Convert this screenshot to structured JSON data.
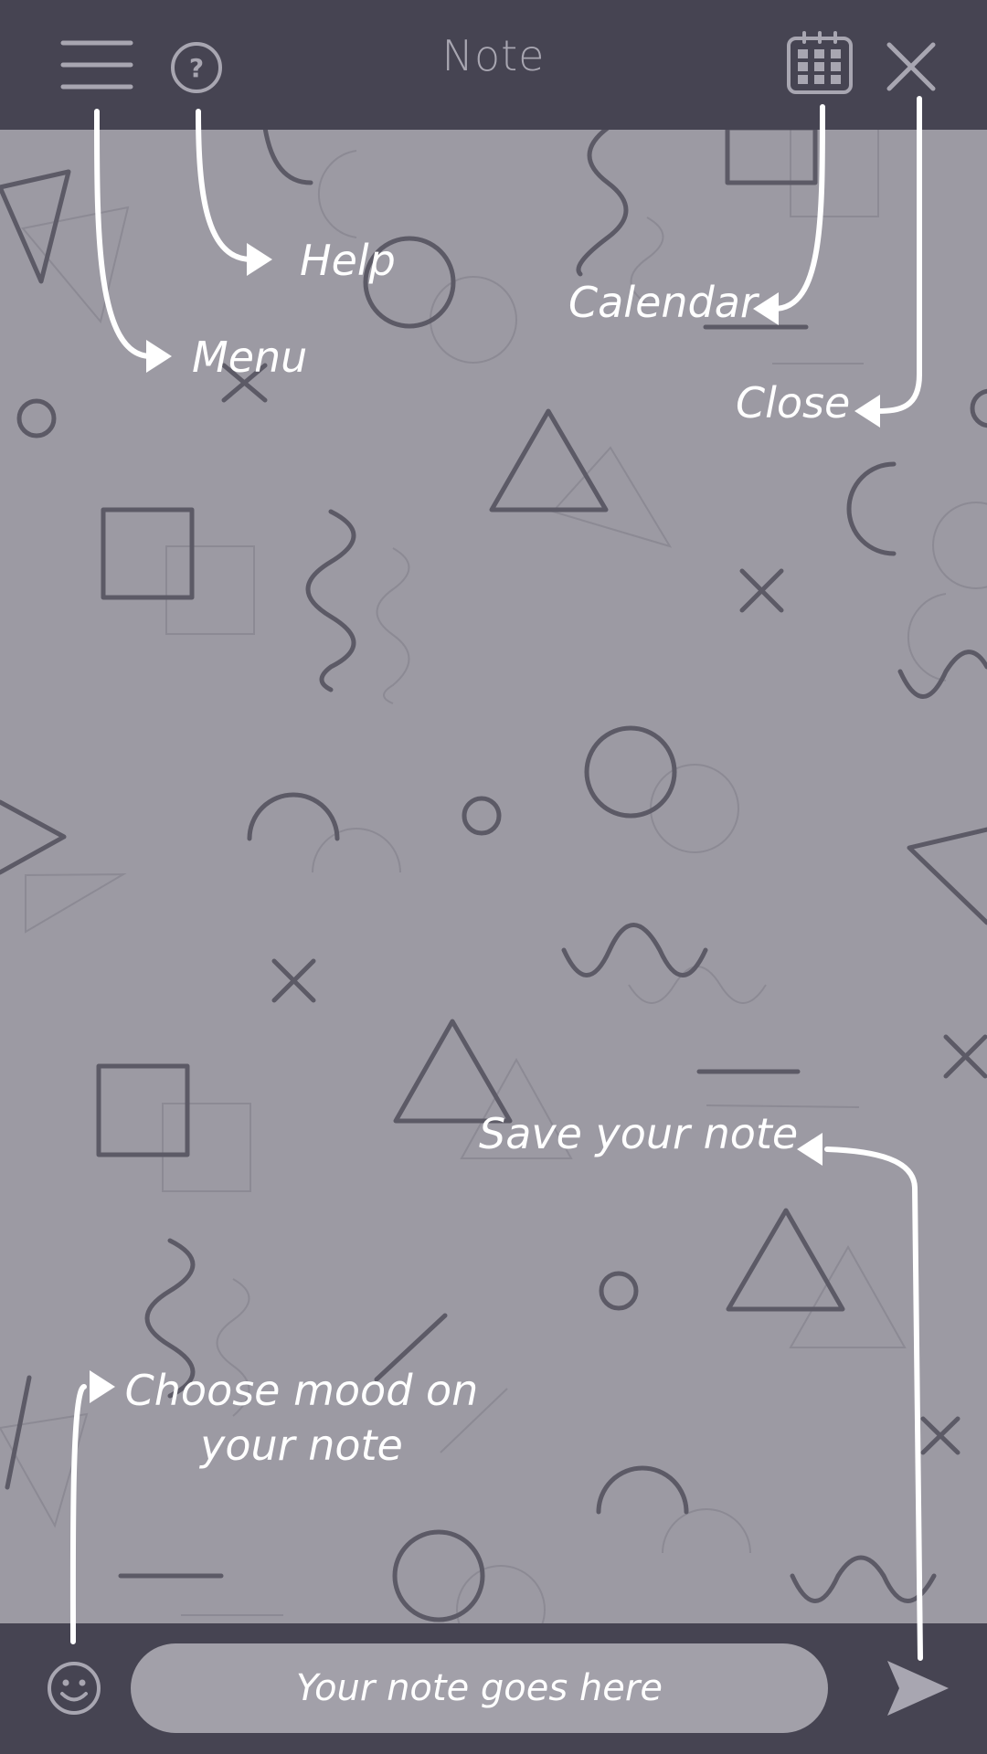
{
  "header": {
    "title": "Note"
  },
  "footer": {
    "note_placeholder": "Your note goes here"
  },
  "annotations": {
    "menu": "Menu",
    "help": "Help",
    "calendar": "Calendar",
    "close": "Close",
    "save": "Save your note",
    "mood_line1": "Choose mood on",
    "mood_line2": "your note"
  },
  "icons": {
    "menu": "hamburger-menu-icon",
    "help": "question-circle-icon",
    "calendar": "calendar-icon",
    "close": "close-icon",
    "mood": "smiley-face-icon",
    "send": "send-arrow-icon"
  },
  "colors": {
    "bar": "#464452",
    "background": "#9c9aa3",
    "icon": "#a8a6b1",
    "input": "#a2a0a9",
    "annotation": "#ffffff"
  }
}
